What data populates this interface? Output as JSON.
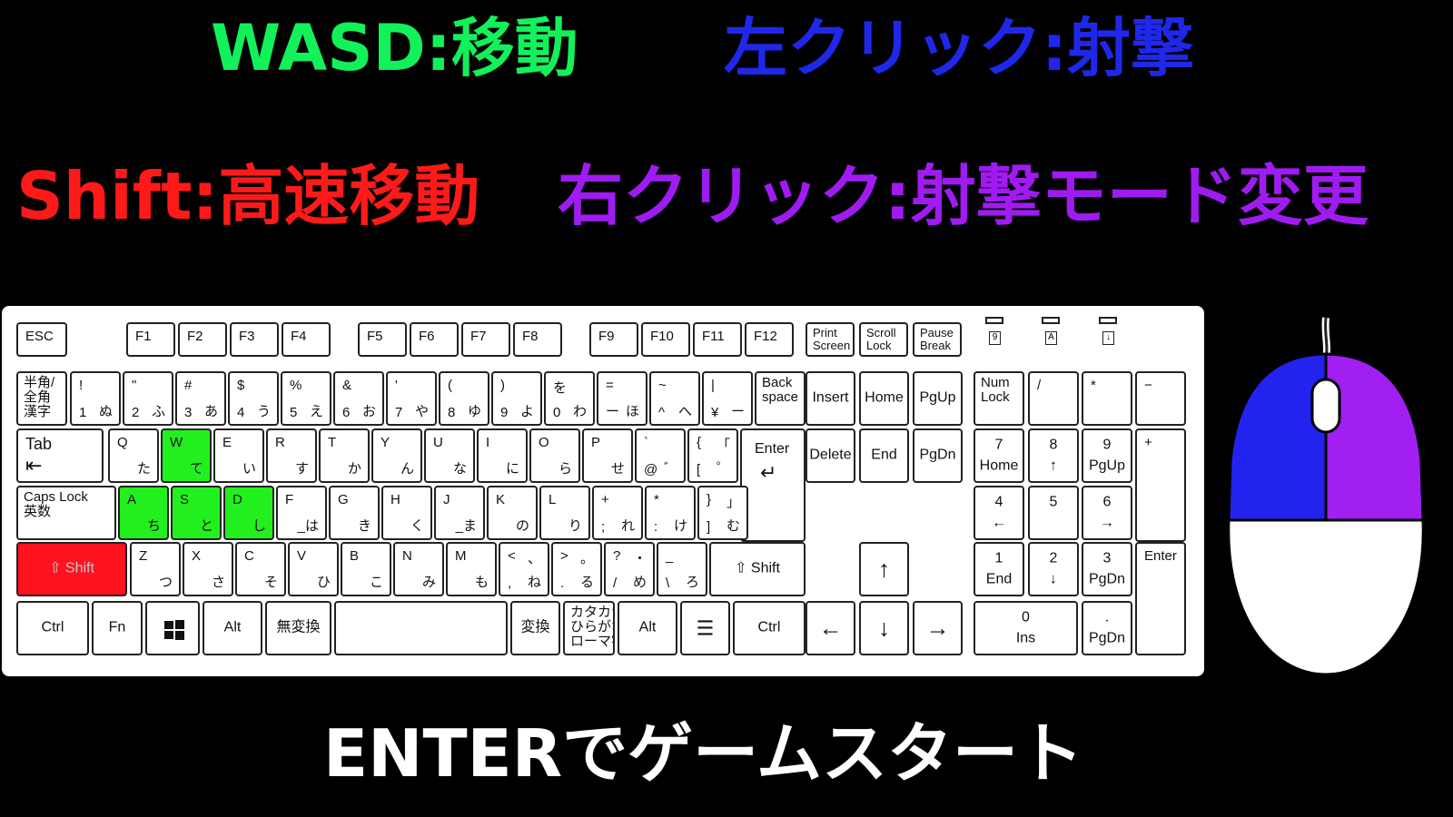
{
  "instructions": {
    "wasd": "WASD:移動",
    "left_click": "左クリック:射撃",
    "shift": "Shift:高速移動",
    "right_click": "右クリック:射撃モード変更",
    "start": "ENTERでゲームスタート"
  },
  "colors": {
    "wasd": "#12f15a",
    "left_click": "#1f28e8",
    "shift": "#ff1a1a",
    "right_click": "#a01bf2",
    "start": "#ffffff",
    "highlight_move": "#22f01e",
    "highlight_shift": "#ff1220",
    "mouse_left": "#2323f0",
    "mouse_right": "#a11ff0"
  },
  "indicators": [
    "9",
    "A",
    "↓"
  ],
  "keys": {
    "esc": "ESC",
    "f1": "F1",
    "f2": "F2",
    "f3": "F3",
    "f4": "F4",
    "f5": "F5",
    "f6": "F6",
    "f7": "F7",
    "f8": "F8",
    "f9": "F9",
    "f10": "F10",
    "f11": "F11",
    "f12": "F12",
    "print": "Print\nScreen",
    "scroll": "Scroll\nLock",
    "pause": "Pause\nBreak",
    "hankaku": "半角/\n全角\n漢字",
    "n1": [
      "!",
      "1",
      "ぬ"
    ],
    "n2": [
      "\"",
      "2",
      "ふ"
    ],
    "n3": [
      "#",
      "3",
      "あ"
    ],
    "n4": [
      "$",
      "4",
      "う"
    ],
    "n5": [
      "%",
      "5",
      "え"
    ],
    "n6": [
      "&",
      "6",
      "お"
    ],
    "n7": [
      "'",
      "7",
      "や"
    ],
    "n8": [
      "(",
      "8",
      "ゆ"
    ],
    "n9": [
      ")",
      "9",
      "よ"
    ],
    "n0": [
      "を",
      "0",
      "わ"
    ],
    "minus": [
      "=",
      "ー",
      "ほ"
    ],
    "caret": [
      "~",
      "^",
      "へ"
    ],
    "yen": [
      "|",
      "¥",
      "ー"
    ],
    "backspace": "Back\nspace",
    "insert": "Insert",
    "home": "Home",
    "pgup": "PgUp",
    "numlock": "Num\nLock",
    "np_slash": "/",
    "np_star": "*",
    "np_minus": "−",
    "tab": "Tab",
    "q": [
      "Q",
      "た"
    ],
    "w": [
      "W",
      "て"
    ],
    "e": [
      "E",
      "い"
    ],
    "r": [
      "R",
      "す"
    ],
    "t": [
      "T",
      "か"
    ],
    "y": [
      "Y",
      "ん"
    ],
    "u": [
      "U",
      "な"
    ],
    "i": [
      "I",
      "に"
    ],
    "o": [
      "O",
      "ら"
    ],
    "p": [
      "P",
      "せ"
    ],
    "at": [
      "`",
      "@",
      "゛"
    ],
    "bracket_open": [
      "{",
      "[",
      "「",
      "゜"
    ],
    "enter": "Enter",
    "delete": "Delete",
    "end": "End",
    "pgdn": "PgDn",
    "np7": [
      "7",
      "Home"
    ],
    "np8": [
      "8",
      "↑"
    ],
    "np9": [
      "9",
      "PgUp"
    ],
    "np_plus": "+",
    "caps": "Caps Lock\n英数",
    "a": [
      "A",
      "ち"
    ],
    "s": [
      "S",
      "と"
    ],
    "d": [
      "D",
      "し"
    ],
    "f": [
      "F",
      "_は"
    ],
    "g": [
      "G",
      "き"
    ],
    "h": [
      "H",
      "く"
    ],
    "j": [
      "J",
      "_ま"
    ],
    "k": [
      "K",
      "の"
    ],
    "l": [
      "L",
      "り"
    ],
    "semi": [
      "+",
      ";",
      "れ"
    ],
    "colon": [
      "*",
      ":",
      "け"
    ],
    "bracket_close": [
      "}",
      "]",
      "」",
      "む"
    ],
    "np4": [
      "4",
      "←"
    ],
    "np5": [
      "5",
      ""
    ],
    "np6": [
      "6",
      "→"
    ],
    "shift_l": "⇧ Shift",
    "z": [
      "Z",
      "つ"
    ],
    "x": [
      "X",
      "さ"
    ],
    "c": [
      "C",
      "そ"
    ],
    "v": [
      "V",
      "ひ"
    ],
    "b": [
      "B",
      "こ"
    ],
    "n": [
      "N",
      "み"
    ],
    "m": [
      "M",
      "も"
    ],
    "comma": [
      "<",
      ",",
      "、",
      "ね"
    ],
    "period": [
      ">",
      ".",
      "。",
      "る"
    ],
    "slash": [
      "?",
      "/",
      "・",
      "め"
    ],
    "backslash": [
      "_",
      "\\",
      "ろ"
    ],
    "shift_r": "⇧ Shift",
    "up": "↑",
    "np1": [
      "1",
      "End"
    ],
    "np2": [
      "2",
      "↓"
    ],
    "np3": [
      "3",
      "PgDn"
    ],
    "np_enter": "Enter",
    "ctrl_l": "Ctrl",
    "fn": "Fn",
    "alt_l": "Alt",
    "muhenkan": "無変換",
    "henkan": "変換",
    "kana": "カタカナ\nひらがな\nローマ字",
    "alt_r": "Alt",
    "ctrl_r": "Ctrl",
    "left": "←",
    "down": "↓",
    "right": "→",
    "np0": [
      "0",
      "Ins"
    ],
    "np_dot": [
      ".",
      "PgDn"
    ]
  }
}
